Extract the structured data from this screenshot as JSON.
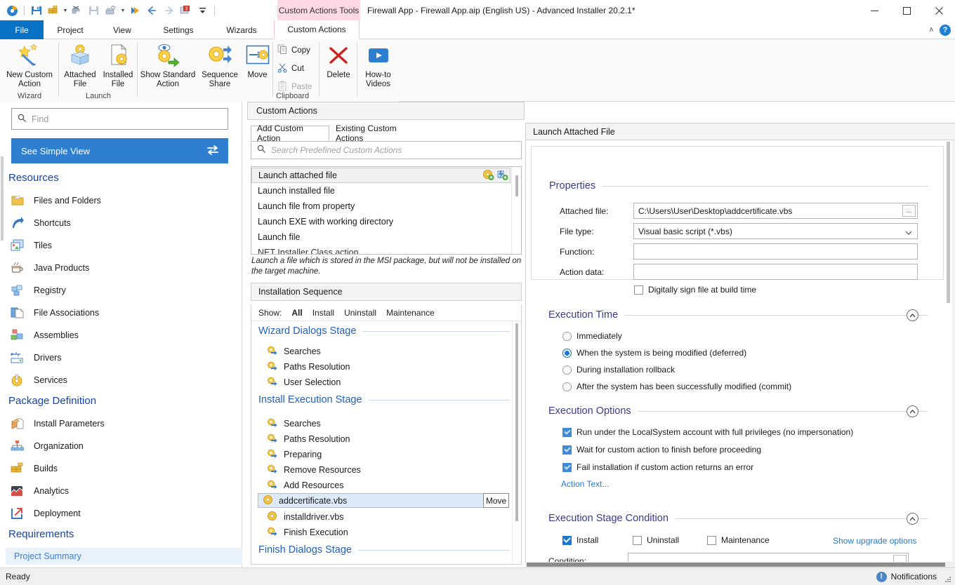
{
  "window": {
    "title": "Firewall App - Firewall App.aip (English US) - Advanced Installer 20.2.1*",
    "contextual_tab_group": "Custom Actions Tools",
    "minimize_label": "Minimize",
    "maximize_label": "Maximize",
    "close_label": "Close"
  },
  "quick_access": [
    {
      "name": "advanced-installer-logo-icon",
      "label": "Advanced Installer"
    },
    {
      "name": "save-icon",
      "label": "Save"
    },
    {
      "name": "build-icon",
      "label": "Build"
    },
    {
      "name": "build-dropdown-caret-icon",
      "label": "Build options"
    },
    {
      "name": "build-run-icon",
      "label": "Build and Run"
    },
    {
      "name": "save-as-icon",
      "label": "Save As"
    },
    {
      "name": "package-icon",
      "label": "Package"
    },
    {
      "name": "package-dropdown-caret-icon",
      "label": "Package options"
    },
    {
      "name": "run-icon",
      "label": "Run"
    },
    {
      "name": "back-icon",
      "label": "Back"
    },
    {
      "name": "forward-icon",
      "label": "Forward"
    },
    {
      "name": "notifications-badge-icon",
      "label": "Notifications",
      "badge": "3"
    },
    {
      "name": "customize-qat-caret-icon",
      "label": "Customize Quick Access Toolbar"
    }
  ],
  "ribbon": {
    "tabs": [
      {
        "id": "file",
        "label": "File"
      },
      {
        "id": "project",
        "label": "Project"
      },
      {
        "id": "view",
        "label": "View"
      },
      {
        "id": "settings",
        "label": "Settings"
      },
      {
        "id": "wizards",
        "label": "Wizards"
      },
      {
        "id": "custom-actions",
        "label": "Custom Actions"
      }
    ],
    "active_tab": "custom-actions",
    "collapse_caret": "∧",
    "help_label": "?",
    "groups": [
      {
        "id": "wizard",
        "name": "Wizard",
        "buttons": [
          {
            "id": "new-custom-action",
            "line1": "New Custom",
            "line2": "Action",
            "icon": "magic-wand-star-icon"
          }
        ]
      },
      {
        "id": "launch",
        "name": "Launch",
        "buttons": [
          {
            "id": "attached-file",
            "line1": "Attached",
            "line2": "File",
            "icon": "attached-file-box-gear-icon"
          },
          {
            "id": "installed-file",
            "line1": "Installed",
            "line2": "File",
            "icon": "installed-file-gear-icon"
          }
        ]
      },
      {
        "id": "standard",
        "name": "",
        "buttons": [
          {
            "id": "show-standard-action",
            "line1": "Show Standard",
            "line2": "Action",
            "icon": "eye-gear-arrow-icon"
          },
          {
            "id": "sequence-share",
            "line1": "Sequence",
            "line2": "Share",
            "icon": "gear-share-icon"
          },
          {
            "id": "move",
            "line1": "Move",
            "line2": "",
            "icon": "move-gear-box-icon"
          }
        ]
      },
      {
        "id": "clipboard",
        "name": "Clipboard",
        "small_buttons": [
          {
            "id": "copy",
            "label": "Copy",
            "icon": "copy-icon",
            "disabled": false
          },
          {
            "id": "cut",
            "label": "Cut",
            "icon": "scissors-icon",
            "disabled": false
          },
          {
            "id": "paste",
            "label": "Paste",
            "icon": "paste-icon",
            "disabled": true
          }
        ]
      },
      {
        "id": "delete-group",
        "name": "",
        "buttons": [
          {
            "id": "delete",
            "line1": "Delete",
            "line2": "",
            "icon": "red-x-delete-icon"
          }
        ]
      },
      {
        "id": "help-group",
        "name": "",
        "buttons": [
          {
            "id": "how-to-videos",
            "line1": "How-to",
            "line2": "Videos",
            "icon": "video-play-icon"
          }
        ]
      }
    ]
  },
  "sidebar": {
    "find_placeholder": "Find",
    "simple_view_label": "See Simple View",
    "sections": [
      {
        "title": "Resources",
        "items": [
          {
            "label": "Files and Folders",
            "icon": "folder-icon"
          },
          {
            "label": "Shortcuts",
            "icon": "shortcut-arrow-icon"
          },
          {
            "label": "Tiles",
            "icon": "tiles-icon"
          },
          {
            "label": "Java Products",
            "icon": "coffee-cup-icon"
          },
          {
            "label": "Registry",
            "icon": "registry-blocks-icon"
          },
          {
            "label": "File Associations",
            "icon": "file-associations-icon"
          },
          {
            "label": "Assemblies",
            "icon": "assemblies-icon"
          },
          {
            "label": "Drivers",
            "icon": "usb-drivers-icon"
          },
          {
            "label": "Services",
            "icon": "services-gear-icon"
          }
        ]
      },
      {
        "title": "Package Definition",
        "items": [
          {
            "label": "Install Parameters",
            "icon": "install-parameters-icon"
          },
          {
            "label": "Organization",
            "icon": "organization-chart-icon"
          },
          {
            "label": "Builds",
            "icon": "builds-bricks-icon"
          },
          {
            "label": "Analytics",
            "icon": "analytics-chart-icon"
          },
          {
            "label": "Deployment",
            "icon": "deployment-arrow-icon"
          }
        ]
      },
      {
        "title": "Requirements",
        "items": []
      }
    ],
    "project_summary_label": "Project Summary"
  },
  "center": {
    "panel_title": "Custom Actions",
    "tabs": [
      {
        "id": "add-custom-action",
        "label": "Add Custom Action",
        "active": true
      },
      {
        "id": "existing-custom-actions",
        "label": "Existing Custom Actions",
        "active": false
      }
    ],
    "search_placeholder": "Search Predefined Custom Actions",
    "predefined_actions": [
      {
        "label": "Launch attached file",
        "selected": true
      },
      {
        "label": "Launch installed file",
        "selected": false
      },
      {
        "label": "Launch file from property",
        "selected": false
      },
      {
        "label": "Launch EXE with working directory",
        "selected": false
      },
      {
        "label": "Launch file",
        "selected": false
      },
      {
        "label": "NET Installer Class action",
        "selected": false
      }
    ],
    "selected_action_icons": [
      {
        "name": "add-custom-action-gear-icon"
      },
      {
        "name": "add-sequence-icon"
      }
    ],
    "description": "Launch a file which is stored in the MSI package, but will not be installed on the target machine.",
    "sequence_panel_title": "Installation Sequence",
    "show_label": "Show:",
    "show_filters": [
      {
        "label": "All",
        "active": true
      },
      {
        "label": "Install",
        "active": false
      },
      {
        "label": "Uninstall",
        "active": false
      },
      {
        "label": "Maintenance",
        "active": false
      }
    ],
    "stages": [
      {
        "title": "Wizard Dialogs Stage",
        "items": [
          {
            "label": "Searches",
            "icon": "standard-action-icon",
            "selected": false
          },
          {
            "label": "Paths Resolution",
            "icon": "standard-action-icon",
            "selected": false
          },
          {
            "label": "User Selection",
            "icon": "standard-action-icon",
            "selected": false
          }
        ]
      },
      {
        "title": "Install Execution Stage",
        "items": [
          {
            "label": "Searches",
            "icon": "standard-action-icon",
            "selected": false
          },
          {
            "label": "Paths Resolution",
            "icon": "standard-action-icon",
            "selected": false
          },
          {
            "label": "Preparing",
            "icon": "standard-action-icon",
            "selected": false
          },
          {
            "label": "Remove Resources",
            "icon": "standard-action-icon",
            "selected": false
          },
          {
            "label": "Add Resources",
            "icon": "standard-action-icon",
            "selected": false
          },
          {
            "label": "addcertificate.vbs",
            "icon": "custom-action-gear-icon",
            "selected": true,
            "button": "Move"
          },
          {
            "label": "installdriver.vbs",
            "icon": "custom-action-gear-icon",
            "selected": false
          },
          {
            "label": "Finish Execution",
            "icon": "standard-action-icon",
            "selected": false
          }
        ]
      },
      {
        "title": "Finish Dialogs Stage",
        "items": []
      }
    ]
  },
  "details": {
    "header": "Launch Attached File",
    "properties": {
      "title": "Properties",
      "attached_file_label": "Attached file:",
      "attached_file_value": "C:\\Users\\User\\Desktop\\addcertificate.vbs",
      "file_type_label": "File type:",
      "file_type_value": "Visual basic script (*.vbs)",
      "function_label": "Function:",
      "function_value": "",
      "action_data_label": "Action data:",
      "action_data_value": "",
      "sign_checkbox_label": "Digitally sign file at build time",
      "sign_checked": false,
      "browse_button": "..."
    },
    "execution_time": {
      "title": "Execution Time",
      "options": [
        {
          "label": "Immediately",
          "selected": false
        },
        {
          "label": "When the system is being modified (deferred)",
          "selected": true
        },
        {
          "label": "During installation rollback",
          "selected": false
        },
        {
          "label": "After the system has been successfully modified (commit)",
          "selected": false
        }
      ]
    },
    "execution_options": {
      "title": "Execution Options",
      "options": [
        {
          "label": "Run under the LocalSystem account with full privileges (no impersonation)",
          "checked": true
        },
        {
          "label": "Wait for custom action to finish before proceeding",
          "checked": true
        },
        {
          "label": "Fail installation if custom action returns an error",
          "checked": true
        }
      ],
      "action_text_link": "Action Text..."
    },
    "execution_stage_condition": {
      "title": "Execution Stage Condition",
      "checkboxes": [
        {
          "label": "Install",
          "checked": true
        },
        {
          "label": "Uninstall",
          "checked": false
        },
        {
          "label": "Maintenance",
          "checked": false
        }
      ],
      "upgrade_link": "Show upgrade options",
      "condition_label": "Condition:",
      "condition_value": "",
      "browse_button": "..."
    }
  },
  "status_bar": {
    "ready_text": "Ready",
    "notifications_label": "Notifications"
  },
  "colors": {
    "accent_blue": "#2f7fd1",
    "section_heading": "#1344a6",
    "stage_heading": "#2060c0",
    "details_heading": "#3b3b8f",
    "contextual_pink": "#ffd9e6",
    "file_tab_blue": "#0a72c4",
    "selection_blue": "#ddeaf9",
    "link_blue": "#2a7ac9"
  }
}
